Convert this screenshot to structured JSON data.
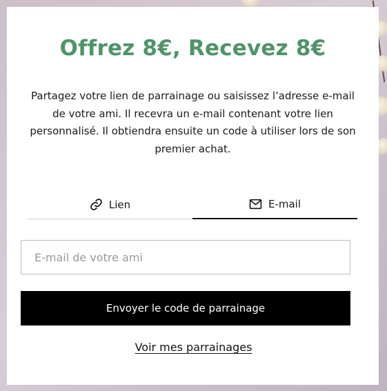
{
  "referral": {
    "title": "Offrez 8€, Recevez 8€",
    "description": "Partagez votre lien de parrainage ou saisissez l’adresse e-mail de votre ami. Il recevra un e-mail contenant votre lien personnalisé. Il obtiendra ensuite un code à utiliser lors de son premier achat.",
    "tabs": [
      {
        "label": "Lien",
        "icon": "link-icon",
        "active": false
      },
      {
        "label": "E-mail",
        "icon": "envelope-icon",
        "active": true
      }
    ],
    "email_input": {
      "placeholder": "E-mail de votre ami",
      "value": ""
    },
    "send_button_label": "Envoyer le code de parrainage",
    "view_referrals_label": "Voir mes parrainages"
  },
  "colors": {
    "title": "#4f9467",
    "button_bg": "#000000",
    "button_text": "#ffffff"
  }
}
